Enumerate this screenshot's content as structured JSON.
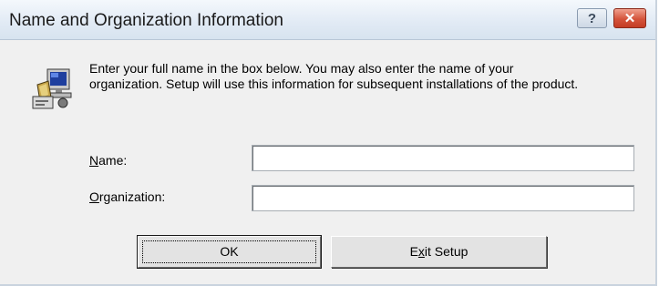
{
  "window": {
    "title": "Name and Organization Information",
    "help_button": "?",
    "close_button": "✕"
  },
  "message": {
    "line1": "Enter your full name in the box below. You may also enter the name of your",
    "line2": "organization. Setup will use this information for subsequent installations of the product."
  },
  "form": {
    "name_label": {
      "accel": "N",
      "rest": "ame:"
    },
    "name_value": "",
    "org_label": {
      "accel": "O",
      "rest": "rganization:"
    },
    "org_value": ""
  },
  "buttons": {
    "ok_label": "OK",
    "exit_label": {
      "pre": "E",
      "accel": "x",
      "rest": "it Setup"
    }
  },
  "icon": "setup-computer-icon"
}
